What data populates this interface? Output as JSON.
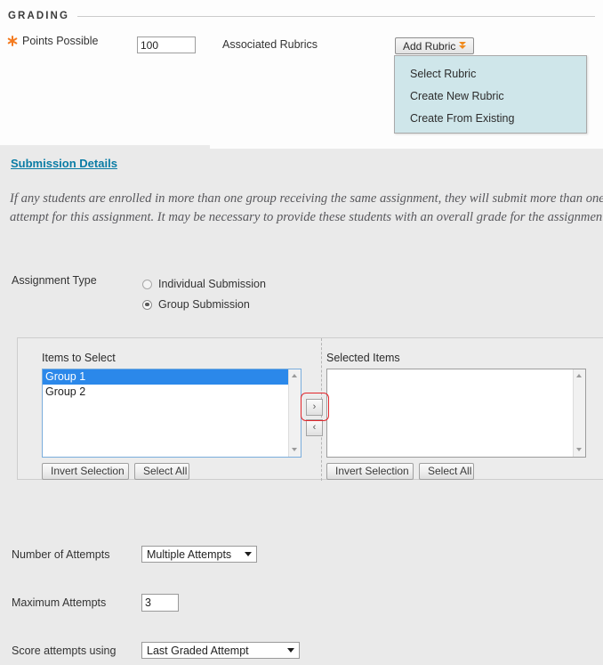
{
  "grading": {
    "section_title": "GRADING",
    "points_possible_label": "Points Possible",
    "points_possible_value": "100",
    "points_possible_placeholder": "",
    "required_icon": "required-asterisk-icon",
    "associated_rubrics_label": "Associated Rubrics",
    "add_rubric_button_label": "Add Rubric",
    "add_rubric_caret_icon": "double-chevron-down-icon",
    "rubric_menu": {
      "background_color": "#cfe6ea",
      "items": [
        {
          "label": "Select Rubric"
        },
        {
          "label": "Create New Rubric"
        },
        {
          "label": "Create From Existing"
        }
      ]
    }
  },
  "submission": {
    "link_label": "Submission Details",
    "link_color": "#0a7ca5",
    "note": "If any students are enrolled in more than one group receiving the same assignment, they will submit more than one attempt for this assignment. It may be necessary to provide these students with an overall grade for the assignment.",
    "assignment_type_label": "Assignment Type",
    "assignment_type_options": [
      {
        "label": "Individual Submission",
        "checked": false
      },
      {
        "label": "Group Submission",
        "checked": true
      }
    ]
  },
  "dual_list": {
    "left_title": "Items to Select",
    "right_title": "Selected Items",
    "left_options": [
      {
        "label": "Group 1",
        "selected": true
      },
      {
        "label": "Group 2",
        "selected": false
      }
    ],
    "right_options": [],
    "transfer_right_label": "›",
    "transfer_left_label": "‹",
    "left_invert_selection_label": "Invert Selection",
    "left_select_all_label": "Select All",
    "right_invert_selection_label": "Invert Selection",
    "right_select_all_label": "Select All",
    "selected_option_color": "#2b88ea",
    "highlight_color": "#e2272c"
  },
  "attempts": {
    "number_of_attempts_label": "Number of Attempts",
    "number_of_attempts_value": "Multiple Attempts",
    "maximum_attempts_label": "Maximum Attempts",
    "maximum_attempts_value": "3",
    "score_attempts_label": "Score attempts using",
    "score_attempts_value": "Last Graded Attempt"
  }
}
